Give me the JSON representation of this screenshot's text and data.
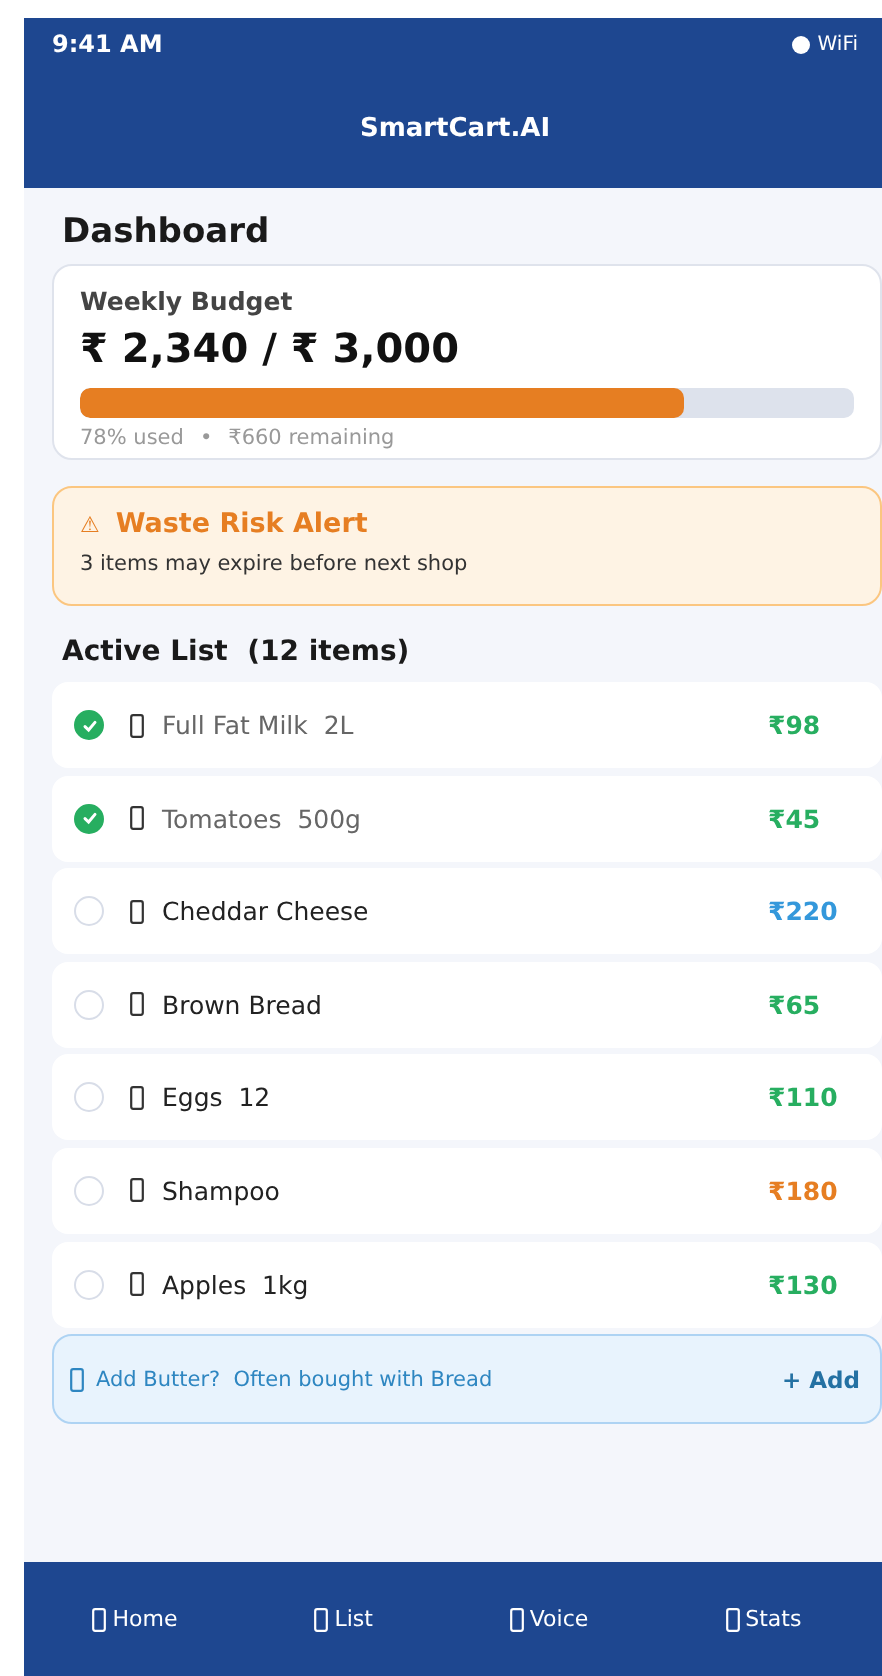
{
  "status_bar": {
    "time": "9:41 AM",
    "wifi": "WiFi"
  },
  "app_bar": {
    "title": "SmartCart.AI"
  },
  "page_title": "Dashboard",
  "budget": {
    "label": "Weekly Budget",
    "amount": "₹ 2,340 / ₹ 3,000",
    "level": 0.78,
    "used": "78% used",
    "separator": "•",
    "remaining": "₹660 remaining"
  },
  "alert": {
    "icon": "⚠",
    "title": "Waste Risk Alert",
    "message": "3 items may expire before next shop"
  },
  "list": {
    "title": "Active List  (12 items)",
    "items": [
      {
        "name": "Full Fat Milk  2L",
        "price": "₹98",
        "color": "#27ae60",
        "checked": true
      },
      {
        "name": "Tomatoes  500g",
        "price": "₹45",
        "color": "#27ae60",
        "checked": true
      },
      {
        "name": "Cheddar Cheese",
        "price": "₹220",
        "color": "#3498db",
        "checked": false
      },
      {
        "name": "Brown Bread",
        "price": "₹65",
        "color": "#27ae60",
        "checked": false
      },
      {
        "name": "Eggs  12",
        "price": "₹110",
        "color": "#27ae60",
        "checked": false
      },
      {
        "name": "Shampoo",
        "price": "₹180",
        "color": "#e67e22",
        "checked": false
      },
      {
        "name": "Apples  1kg",
        "price": "₹130",
        "color": "#27ae60",
        "checked": false
      }
    ]
  },
  "suggestion": {
    "text": "Add Butter?  Often bought with Bread",
    "action": "+ Add"
  },
  "nav": [
    {
      "label": "Home"
    },
    {
      "label": "List"
    },
    {
      "label": "Voice"
    },
    {
      "label": "Stats"
    }
  ]
}
